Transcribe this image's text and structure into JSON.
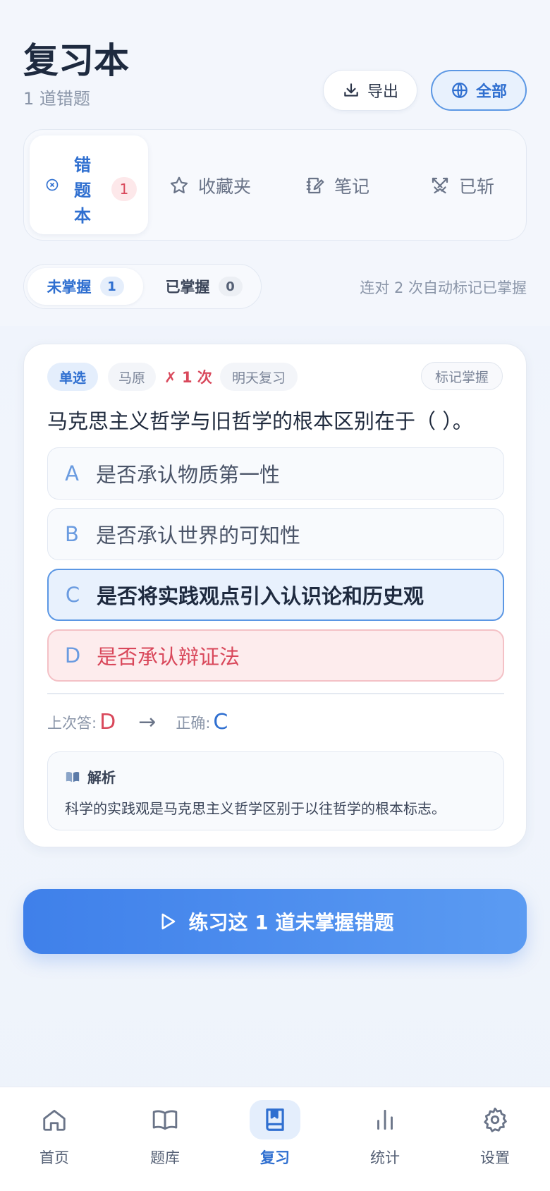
{
  "header": {
    "title": "复习本",
    "subtitle": "1 道错题",
    "export_label": "导出",
    "all_label": "全部"
  },
  "tabs": {
    "active": {
      "label": "错题本",
      "label_chars": [
        "错",
        "题",
        "本"
      ],
      "count": "1"
    },
    "favorites": "收藏夹",
    "notes": "笔记",
    "cleared": "已斩"
  },
  "segment": {
    "unmastered_label": "未掌握",
    "unmastered_count": "1",
    "mastered_label": "已掌握",
    "mastered_count": "0",
    "hint": "连对 2 次自动标记已掌握"
  },
  "question": {
    "type_tag": "单选",
    "subject_tag": "马原",
    "wrong_tag": "✗ 1 次",
    "review_tag": "明天复习",
    "mark_button": "标记掌握",
    "text": "马克思主义哲学与旧哲学的根本区别在于（ ）。",
    "options": [
      {
        "letter": "A",
        "text": "是否承认物质第一性",
        "state": "normal"
      },
      {
        "letter": "B",
        "text": "是否承认世界的可知性",
        "state": "normal"
      },
      {
        "letter": "C",
        "text": "是否将实践观点引入认识论和历史观",
        "state": "correct"
      },
      {
        "letter": "D",
        "text": "是否承认辩证法",
        "state": "wrong"
      }
    ],
    "last_answer_label": "上次答:",
    "last_answer": "D",
    "arrow": "→",
    "correct_label": "正确:",
    "correct_answer": "C",
    "explanation_title": "解析",
    "explanation_text": "科学的实践观是马克思主义哲学区别于以往哲学的根本标志。"
  },
  "cta": {
    "label": "练习这 1 道未掌握错题"
  },
  "nav": {
    "home": "首页",
    "bank": "题库",
    "review": "复习",
    "stats": "统计",
    "settings": "设置"
  },
  "colors": {
    "accent": "#2f6fd0",
    "danger": "#d9485b",
    "cta_start": "#3f80ea",
    "cta_end": "#5b9bf2"
  }
}
